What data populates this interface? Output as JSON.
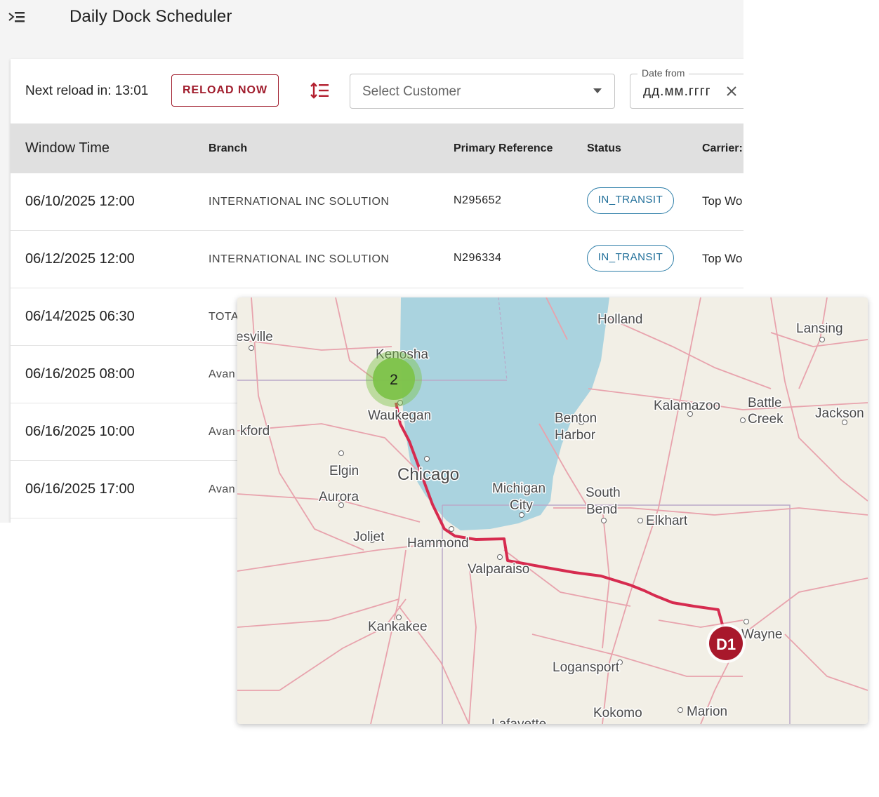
{
  "app": {
    "title": "Daily Dock Scheduler"
  },
  "toolbar": {
    "reload_text": "Next reload in: 13:01",
    "reload_button": "RELOAD NOW",
    "customer_placeholder": "Select Customer",
    "date_label": "Date from",
    "date_placeholder": "дд.мм.гггг"
  },
  "table": {
    "columns": [
      "Window Time",
      "Branch",
      "Primary Reference",
      "Status",
      "Carrier:"
    ],
    "rows": [
      {
        "time": "06/10/2025 12:00",
        "branch": "INTERNATIONAL INC SOLUTION",
        "ref": "N295652",
        "status": "IN_TRANSIT",
        "carrier": "Top Wo"
      },
      {
        "time": "06/12/2025 12:00",
        "branch": "INTERNATIONAL INC SOLUTION",
        "ref": "N296334",
        "status": "IN_TRANSIT",
        "carrier": "Top Wo"
      },
      {
        "time": "06/14/2025 06:30",
        "branch": "TOTA",
        "ref": "",
        "status": "",
        "carrier": ""
      },
      {
        "time": "06/16/2025 08:00",
        "branch": "Avan",
        "ref": "",
        "status": "",
        "carrier": ""
      },
      {
        "time": "06/16/2025 10:00",
        "branch": "Avan",
        "ref": "",
        "status": "",
        "carrier": ""
      },
      {
        "time": "06/16/2025 17:00",
        "branch": "Avan",
        "ref": "",
        "status": "",
        "carrier": ""
      }
    ]
  },
  "map": {
    "cities": {
      "holland": "Holland",
      "lansing": "Lansing",
      "kenosha": "Kenosha",
      "janesville": "esville",
      "kalamazoo": "Kalamazoo",
      "battle": "Battle",
      "creek": "Creek",
      "jackson": "Jackson",
      "waukegan": "Waukegan",
      "benton": "Benton",
      "harbor": "Harbor",
      "rockford": "kford",
      "elgin": "Elgin",
      "chicago": "Chicago",
      "michigan": "Michigan",
      "city": "City",
      "south": "South",
      "bend": "Bend",
      "aurora": "Aurora",
      "elkhart": "Elkhart",
      "joliet": "Joliet",
      "hammond": "Hammond",
      "valparaiso": "Valparaiso",
      "kankakee": "Kankakee",
      "wayne": "Wayne",
      "logansport": "Logansport",
      "kokomo": "Kokomo",
      "marion": "Marion",
      "lafayette": "Lafayette"
    },
    "cluster_count": "2",
    "destination_label": "D1",
    "route_color": "#d62b4f",
    "cluster_color": "#7dc34a",
    "destination_color": "#a8182b",
    "water_color": "#aad3df"
  }
}
